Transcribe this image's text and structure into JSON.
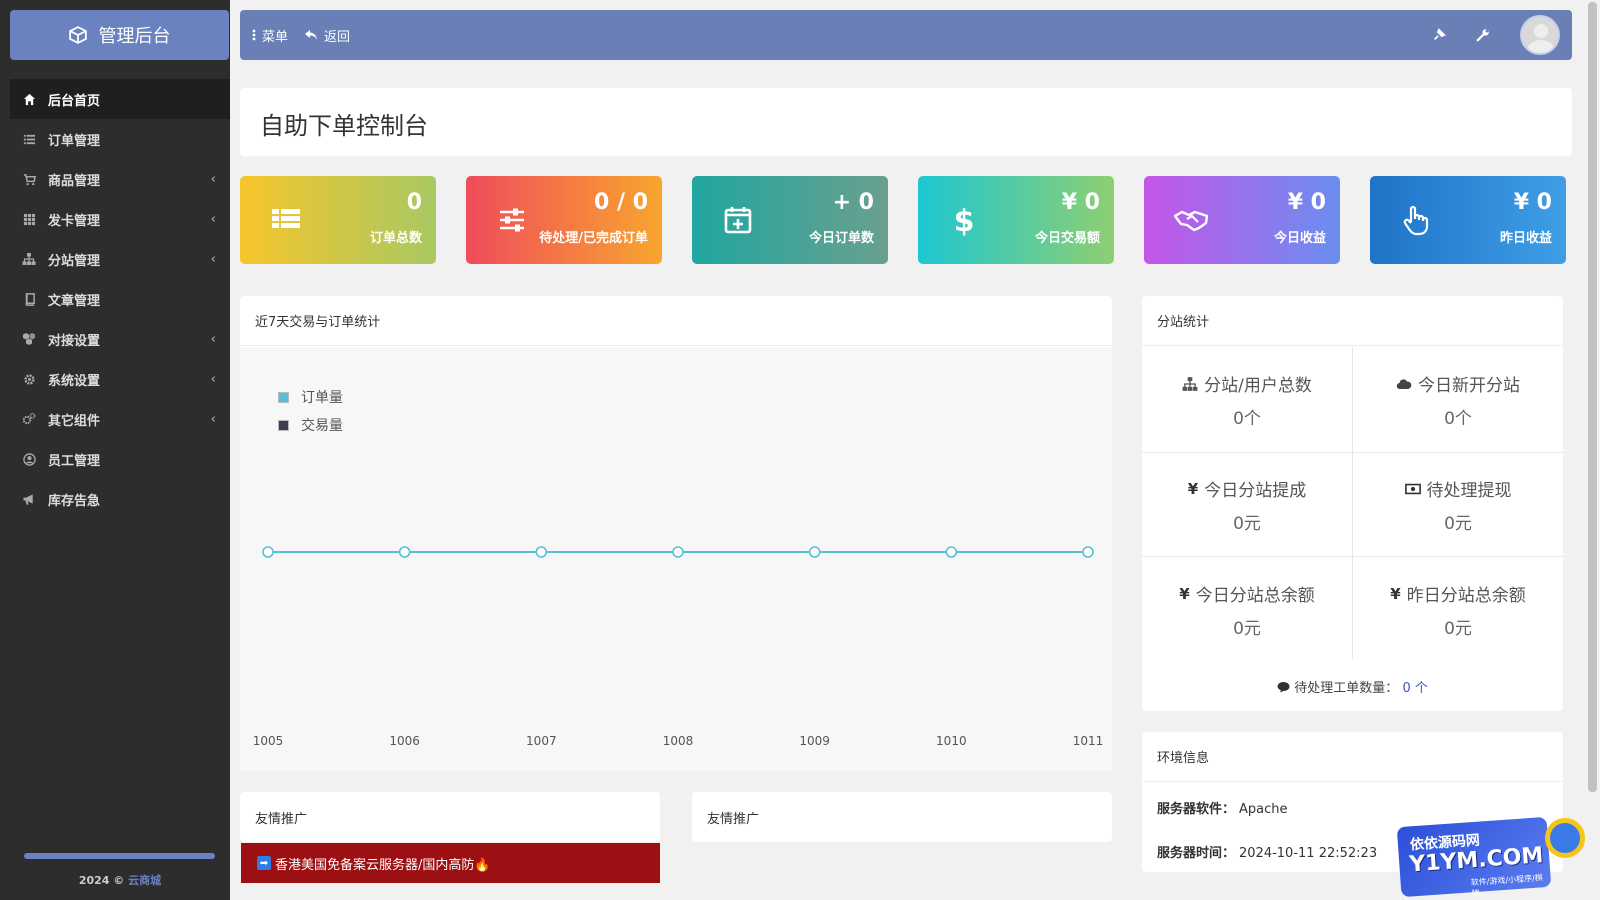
{
  "brand": {
    "title": "管理后台",
    "icon": "cube-icon"
  },
  "sidebar": {
    "items": [
      {
        "label": "后台首页",
        "icon": "home-icon",
        "active": true,
        "chevron": false
      },
      {
        "label": "订单管理",
        "icon": "list-icon",
        "active": false,
        "chevron": false
      },
      {
        "label": "商品管理",
        "icon": "cart-icon",
        "active": false,
        "chevron": true
      },
      {
        "label": "发卡管理",
        "icon": "grid-icon",
        "active": false,
        "chevron": true
      },
      {
        "label": "分站管理",
        "icon": "sitemap-icon",
        "active": false,
        "chevron": true
      },
      {
        "label": "文章管理",
        "icon": "book-icon",
        "active": false,
        "chevron": false
      },
      {
        "label": "对接设置",
        "icon": "cubes-icon",
        "active": false,
        "chevron": true
      },
      {
        "label": "系统设置",
        "icon": "gear-icon",
        "active": false,
        "chevron": true
      },
      {
        "label": "其它组件",
        "icon": "gears-icon",
        "active": false,
        "chevron": true
      },
      {
        "label": "员工管理",
        "icon": "user-circle-icon",
        "active": false,
        "chevron": false
      },
      {
        "label": "库存告急",
        "icon": "bullhorn-icon",
        "active": false,
        "chevron": false
      }
    ],
    "footer_year": "2024 ©",
    "footer_link": "云商城"
  },
  "topbar": {
    "menu_label": "菜单",
    "back_label": "返回"
  },
  "page": {
    "title": "自助下单控制台"
  },
  "stats": [
    {
      "value": "0",
      "label": "订单总数",
      "icon": "table-icon",
      "gradient": [
        "#f7c52c",
        "#a8c862"
      ]
    },
    {
      "value": "0 / 0",
      "label": "待处理/已完成订单",
      "icon": "sliders-icon",
      "gradient": [
        "#ef4c5a",
        "#f8a52e"
      ]
    },
    {
      "value": "+ 0",
      "label": "今日订单数",
      "icon": "calendar-plus-icon",
      "gradient": [
        "#20a6a0",
        "#6aa08f"
      ]
    },
    {
      "value": "¥ 0",
      "label": "今日交易额",
      "icon": "dollar-icon",
      "gradient": [
        "#1ec7d2",
        "#8ecf71"
      ]
    },
    {
      "value": "¥ 0",
      "label": "今日收益",
      "icon": "handshake-icon",
      "gradient": [
        "#c456e8",
        "#6a8ef0"
      ]
    },
    {
      "value": "¥ 0",
      "label": "昨日收益",
      "icon": "hand-pointer-icon",
      "gradient": [
        "#1f73c8",
        "#3f9ee6"
      ]
    }
  ],
  "chart_panel": {
    "title": "近7天交易与订单统计"
  },
  "chart_data": {
    "type": "line",
    "categories": [
      "1005",
      "1006",
      "1007",
      "1008",
      "1009",
      "1010",
      "1011"
    ],
    "series": [
      {
        "name": "订单量",
        "values": [
          0,
          0,
          0,
          0,
          0,
          0,
          0
        ],
        "color": "#56c0d6"
      },
      {
        "name": "交易量",
        "values": [
          0,
          0,
          0,
          0,
          0,
          0,
          0
        ],
        "color": "#3b3f52"
      }
    ],
    "legend": "top-left",
    "grid": false
  },
  "sub_stats": {
    "title": "分站统计",
    "cells": [
      {
        "label": "分站/用户总数",
        "value": "0个",
        "icon": "sitemap-icon"
      },
      {
        "label": "今日新开分站",
        "value": "0个",
        "icon": "cloud-icon"
      },
      {
        "label": "今日分站提成",
        "value": "0元",
        "icon": "yen-icon"
      },
      {
        "label": "待处理提现",
        "value": "0元",
        "icon": "money-bill-icon"
      },
      {
        "label": "今日分站总余额",
        "value": "0元",
        "icon": "yen-icon"
      },
      {
        "label": "昨日分站总余额",
        "value": "0元",
        "icon": "yen-icon"
      }
    ],
    "ticket_label": "待处理工单数量：",
    "ticket_value": "0 个"
  },
  "env": {
    "title": "环境信息",
    "server_software_label": "服务器软件：",
    "server_software": "Apache",
    "server_time_label": "服务器时间：",
    "server_time": "2024-10-11 22:52:23"
  },
  "friends": {
    "panel1_title": "友情推广",
    "panel2_title": "友情推广",
    "ad_text": "香港美国免备案云服务器/国内高防🔥"
  },
  "watermark": {
    "line1": "依依源码网",
    "line2": "Y1YM.COM",
    "line3": "软件/游戏/小程序/棋牌"
  }
}
